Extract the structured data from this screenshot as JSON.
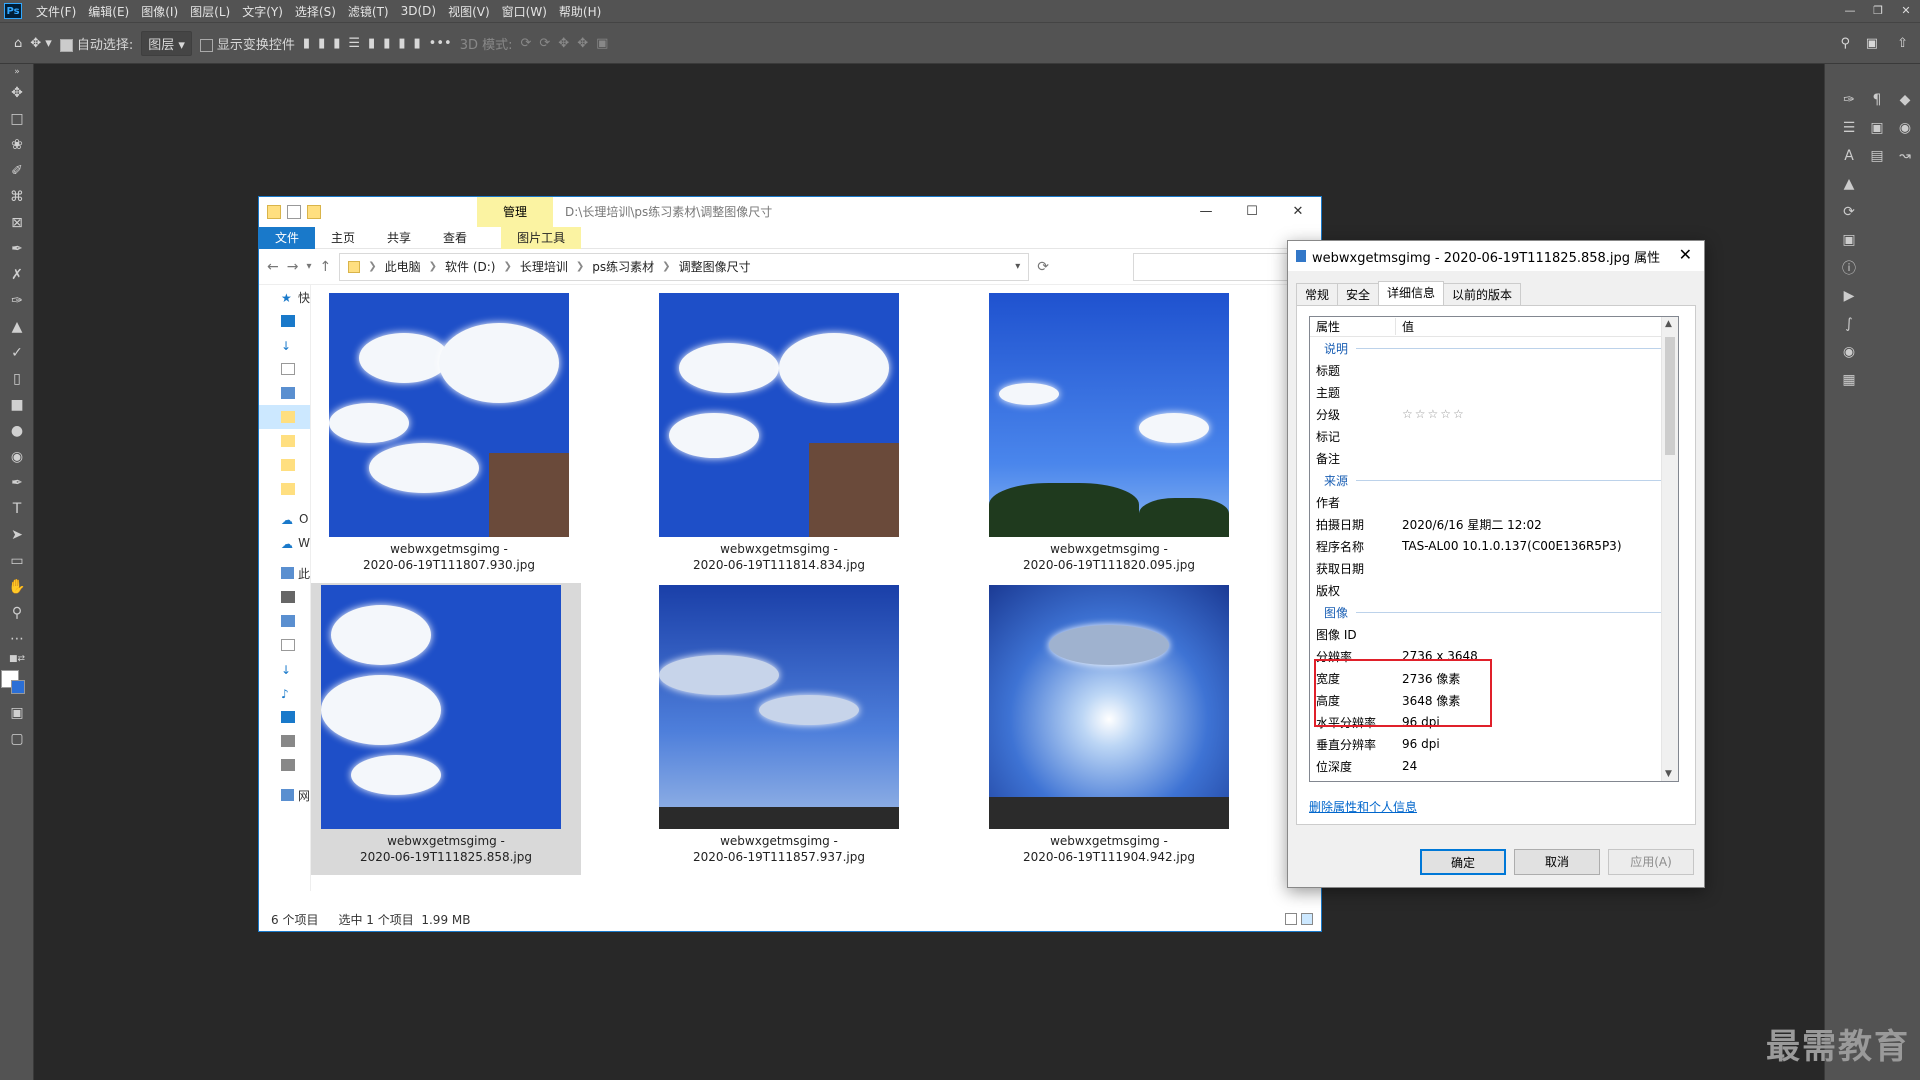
{
  "menubar": {
    "items": [
      "文件(F)",
      "编辑(E)",
      "图像(I)",
      "图层(L)",
      "文字(Y)",
      "选择(S)",
      "滤镜(T)",
      "3D(D)",
      "视图(V)",
      "窗口(W)",
      "帮助(H)"
    ],
    "logo": "Ps"
  },
  "options": {
    "auto_select": "自动选择:",
    "layer": "图层",
    "show_transform": "显示变换控件",
    "mode3d": "3D 模式:",
    "more": "•••"
  },
  "explorer": {
    "manage_tab": "管理",
    "path_title": "D:\\长理培训\\ps练习素材\\调整图像尺寸",
    "ribbon": [
      "文件",
      "主页",
      "共享",
      "查看"
    ],
    "ribbon_pic": "图片工具",
    "breadcrumb": [
      "此电脑",
      "软件 (D:)",
      "长理培训",
      "ps练习素材",
      "调整图像尺寸"
    ],
    "nav": [
      "快",
      "l",
      "↓",
      "l",
      "l",
      "l",
      "l",
      "l",
      "l",
      "O",
      "W",
      "此",
      "l",
      "l",
      "l",
      "l",
      "l",
      "l",
      "l",
      "l",
      "网"
    ],
    "items": [
      {
        "line1": "webwxgetmsgimg -",
        "line2": "2020-06-19T111807.930.jpg"
      },
      {
        "line1": "webwxgetmsgimg -",
        "line2": "2020-06-19T111814.834.jpg"
      },
      {
        "line1": "webwxgetmsgimg -",
        "line2": "2020-06-19T111820.095.jpg"
      },
      {
        "line1": "webwxgetmsgimg -",
        "line2": "2020-06-19T111825.858.jpg"
      },
      {
        "line1": "webwxgetmsgimg -",
        "line2": "2020-06-19T111857.937.jpg"
      },
      {
        "line1": "webwxgetmsgimg -",
        "line2": "2020-06-19T111904.942.jpg"
      }
    ],
    "status_count": "6 个项目",
    "status_selected": "选中 1 个项目",
    "status_size": "1.99 MB"
  },
  "props": {
    "title": "webwxgetmsgimg - 2020-06-19T111825.858.jpg 属性",
    "tabs": [
      "常规",
      "安全",
      "详细信息",
      "以前的版本"
    ],
    "col_prop": "属性",
    "col_value": "值",
    "sec_desc": "说明",
    "sec_origin": "来源",
    "sec_image": "图像",
    "rows_desc": [
      {
        "k": "标题",
        "v": ""
      },
      {
        "k": "主题",
        "v": ""
      },
      {
        "k": "分级",
        "v": "☆☆☆☆☆"
      },
      {
        "k": "标记",
        "v": ""
      },
      {
        "k": "备注",
        "v": ""
      }
    ],
    "rows_origin": [
      {
        "k": "作者",
        "v": ""
      },
      {
        "k": "拍摄日期",
        "v": "2020/6/16 星期二 12:02"
      },
      {
        "k": "程序名称",
        "v": "TAS-AL00 10.1.0.137(C00E136R5P3)"
      },
      {
        "k": "获取日期",
        "v": ""
      },
      {
        "k": "版权",
        "v": ""
      }
    ],
    "rows_image": [
      {
        "k": "图像 ID",
        "v": ""
      },
      {
        "k": "分辨率",
        "v": "2736 x 3648"
      },
      {
        "k": "宽度",
        "v": "2736 像素"
      },
      {
        "k": "高度",
        "v": "3648 像素"
      },
      {
        "k": "水平分辨率",
        "v": "96 dpi"
      },
      {
        "k": "垂直分辨率",
        "v": "96 dpi"
      },
      {
        "k": "位深度",
        "v": "24"
      }
    ],
    "remove_link": "删除属性和个人信息",
    "ok": "确定",
    "cancel": "取消",
    "apply": "应用(A)"
  },
  "watermark": "最需教育"
}
